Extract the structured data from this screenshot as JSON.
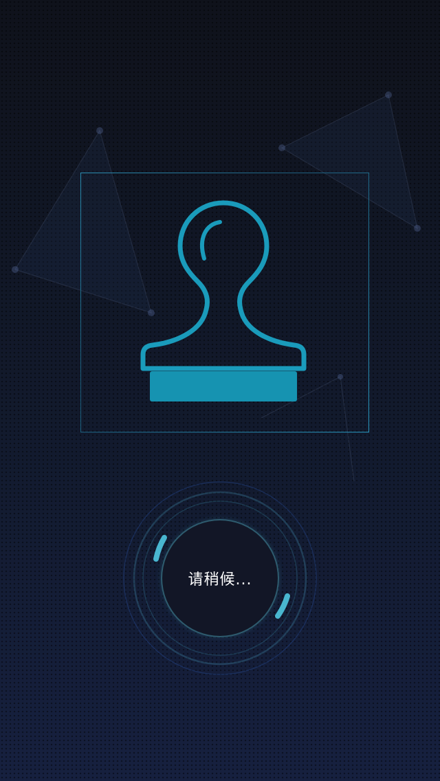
{
  "loading": {
    "message": "请稍候..."
  },
  "colors": {
    "accent": "#1a9bbb",
    "stamp_fill": "#1693b1",
    "frame": "#2a8db0",
    "loader_arc": "#49b6d0",
    "background_top": "#0f121b",
    "background_bottom": "#16203f"
  },
  "icons": {
    "stamp": "stamp-icon",
    "spinner": "loading-spinner"
  }
}
